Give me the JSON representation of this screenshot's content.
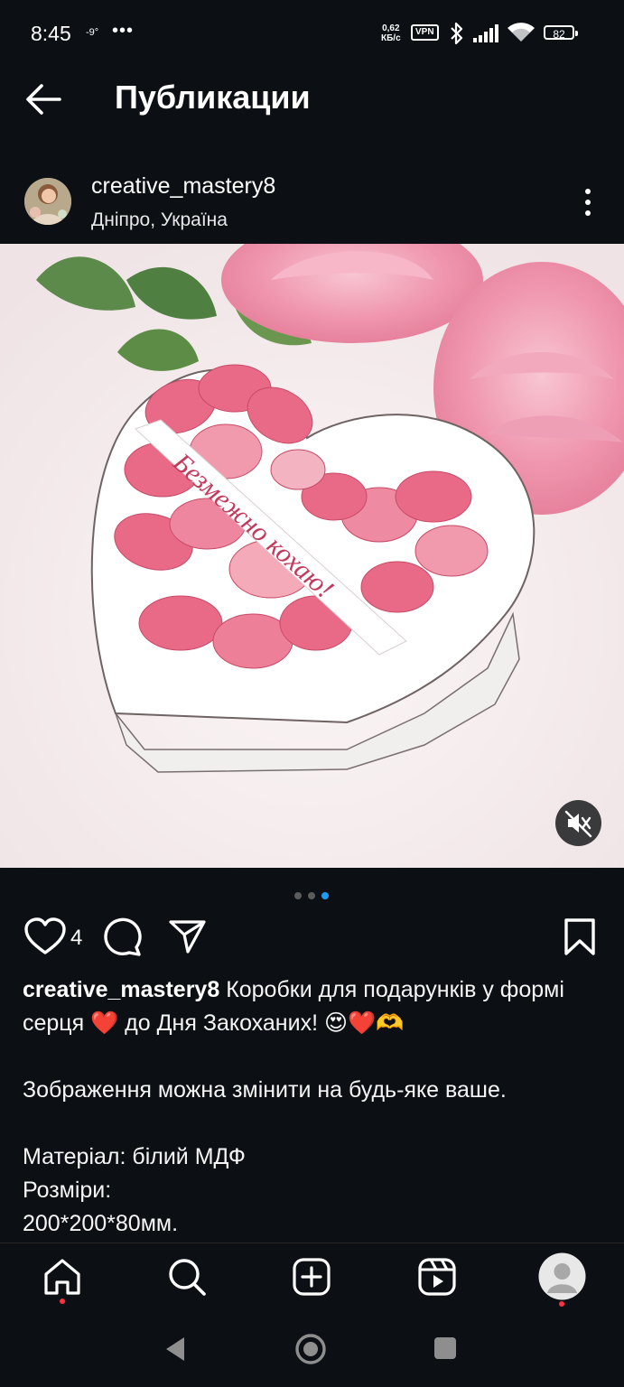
{
  "status_bar": {
    "time": "8:45",
    "temperature": "-9°",
    "more": "•••",
    "speed_value": "0,62",
    "speed_unit": "КБ/с",
    "vpn": "VPN",
    "battery": "82"
  },
  "header": {
    "title": "Публикации"
  },
  "post": {
    "username": "creative_mastery8",
    "location": "Дніпро, Україна",
    "image_text": "Безмежно кохаю!",
    "carousel": {
      "count": 3,
      "active_index": 2
    },
    "likes": "4",
    "caption": {
      "username": "creative_mastery8",
      "line1": "Коробки для подарунків у формі серця ❤️ до Дня Закоханих! 😍❤️🫶",
      "line2": "Зображення можна змінити на будь-яке ваше.",
      "line3": "Матеріал: білий МДФ",
      "line4": "Розміри:",
      "line5": "200*200*80мм."
    }
  },
  "colors": {
    "background": "#0c1014",
    "text": "#f5f5f5",
    "active_dot": "#1d9bf0",
    "notification": "#ff3040"
  },
  "icons": {
    "back": "arrow-left-icon",
    "more": "vertical-dots-icon",
    "mute": "speaker-muted-icon",
    "like": "heart-icon",
    "comment": "comment-bubble-icon",
    "share": "paper-plane-icon",
    "save": "bookmark-icon",
    "nav": [
      "home-icon",
      "search-icon",
      "create-plus-icon",
      "reels-icon",
      "profile-avatar"
    ]
  }
}
